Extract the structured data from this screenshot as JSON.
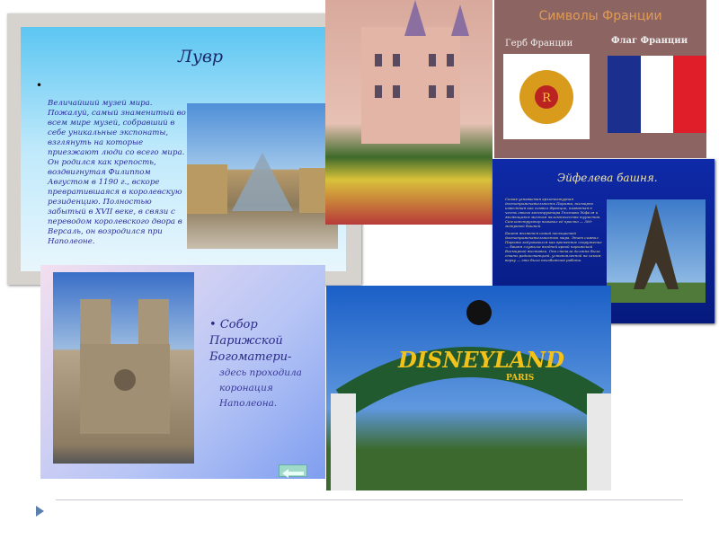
{
  "louvre": {
    "title": "Лувр",
    "text": "Величайший музей мира. Пожалуй, самый знаменитый во всем мире музей, собравший в себе уникальные экспонаты, взглянуть на которые приезжают люди со всего мира. Он родился как крепость, воздвигнутая Филиппом Августом в 1190 г., вскоре превратившаяся в королевскую резиденцию. Полностью забытый в XVII веке, в связи с переводом королевского двора в Версаль, он возродился при Наполеоне."
  },
  "notre_dame": {
    "title": "Собор Парижской Богоматери-",
    "subtitle": "здесь проходила коронация Наполеона."
  },
  "symbols": {
    "title": "Символы Франции",
    "coat_label": "Герб Франции",
    "flag_label": "Флаг Франции"
  },
  "eiffel": {
    "title": "Эйфелева башня.",
    "text1": "Самая узнаваемая архитектурная достопримечательность Парижа, всемирно известная как символ Франции, названная в честь своего конструктора Гюстава Эйфеля и являющаяся местом паломничества туристов. Сам конструктор называл её просто — 300-метровой башней.",
    "text2": "Башня является самой посещаемой достопримечательностью мира. Этот символ Парижа задумывался как временное сооружение — башня служила входной аркой парижской Всемирной выставки. Она сначала должна была стать радиостанцией, установленной на самом верху — это была неизбежная работа."
  },
  "disneyland": {
    "sign": "DISNEYLAND",
    "sub": "PARIS"
  }
}
